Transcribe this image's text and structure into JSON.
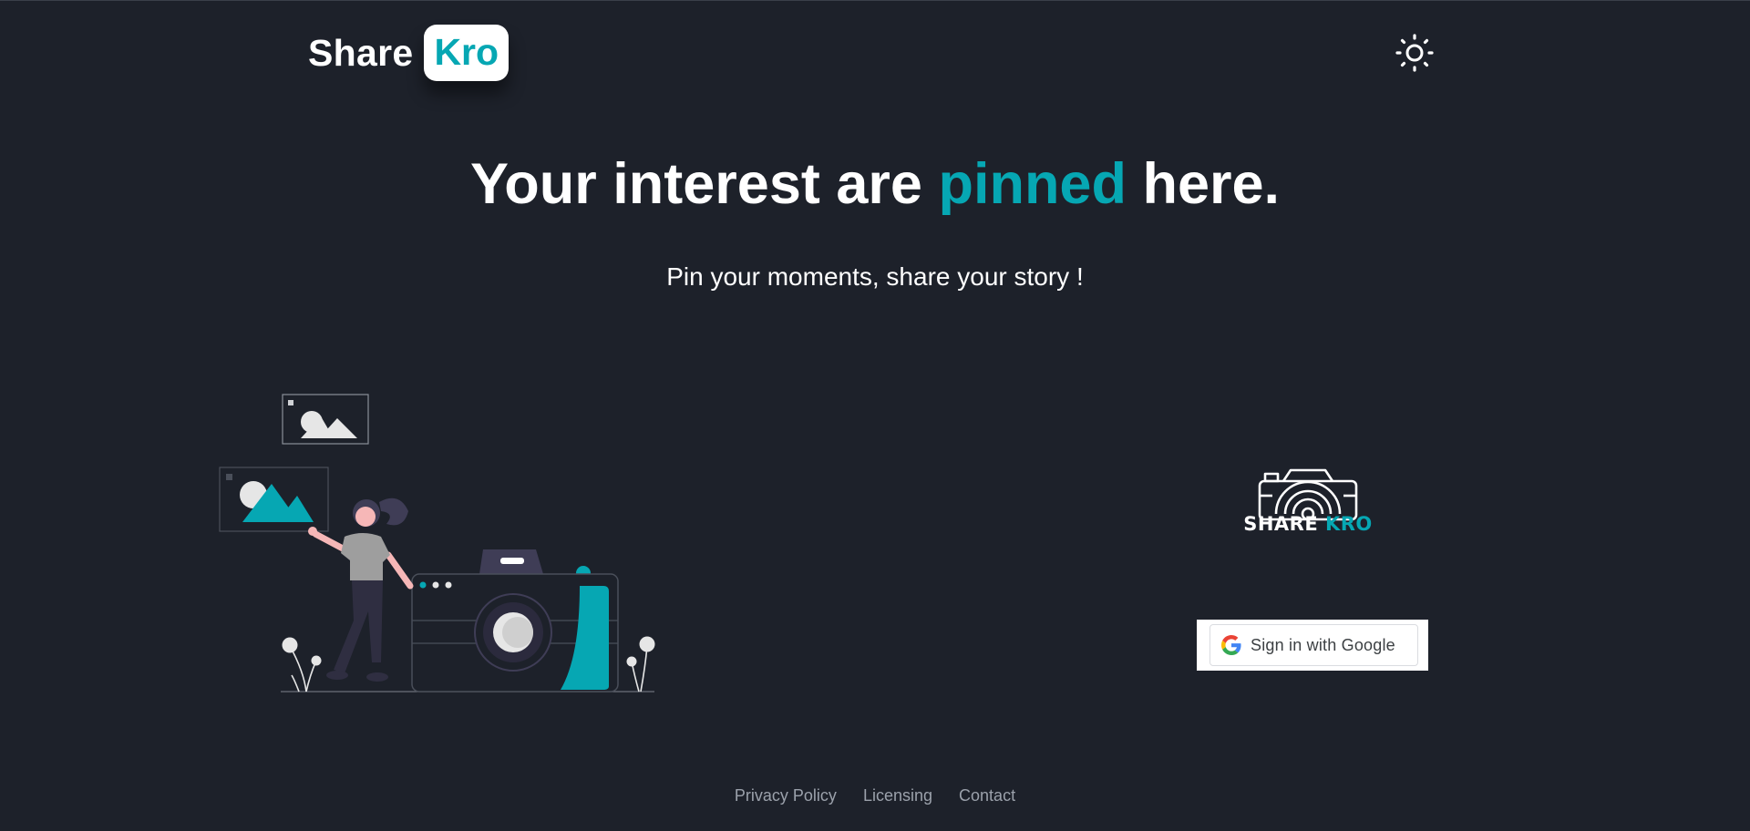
{
  "header": {
    "logo_share": "Share",
    "logo_kro": "Kro",
    "theme_toggle_icon": "sun-icon"
  },
  "hero": {
    "headline_before": "Your interest are ",
    "headline_accent": "pinned",
    "headline_after": " here.",
    "subheadline": "Pin your moments, share your story !"
  },
  "brand": {
    "mark_icon": "camera-icon",
    "mark_share": "SHARE ",
    "mark_kro": "KRO"
  },
  "auth": {
    "google_label": "Sign in with Google",
    "google_icon": "google-g-icon"
  },
  "footer": {
    "links": [
      "Privacy Policy",
      "Licensing",
      "Contact"
    ]
  },
  "colors": {
    "background": "#1d212a",
    "accent": "#06a7b3",
    "text": "#ffffff",
    "footer_link": "#9ba1ab"
  }
}
